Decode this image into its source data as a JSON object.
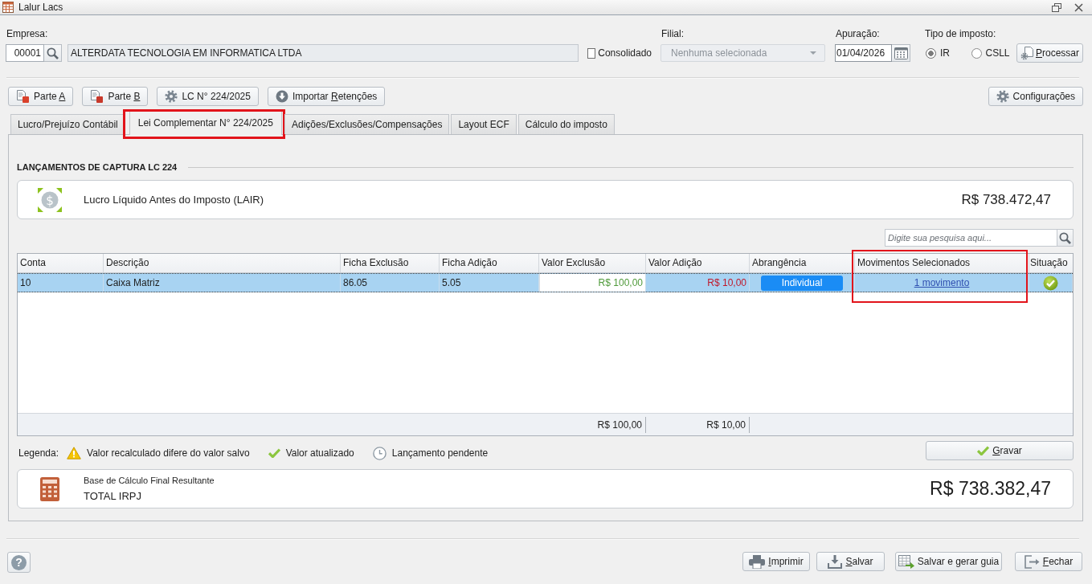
{
  "window": {
    "title": "Lalur Lacs"
  },
  "empresa": {
    "label": "Empresa:",
    "code": "00001",
    "name": "ALTERDATA TECNOLOGIA EM INFORMATICA LTDA"
  },
  "consolidado": {
    "label": "Consolidado",
    "checked": false
  },
  "filial": {
    "label": "Filial:",
    "value": "Nenhuma selecionada",
    "disabled": true
  },
  "apuracao": {
    "label": "Apuração:",
    "value": "01/04/2026"
  },
  "tipo_imposto": {
    "label": "Tipo de imposto:",
    "options": [
      {
        "label": "IR",
        "selected": true
      },
      {
        "label": "CSLL",
        "selected": false
      }
    ]
  },
  "processar_button": {
    "key": "P",
    "after": "rocessar"
  },
  "toolbar": {
    "left": [
      {
        "kind": "part_a",
        "before": "Parte ",
        "key": "A"
      },
      {
        "kind": "part_b",
        "before": "Parte ",
        "key": "B"
      },
      {
        "kind": "gear",
        "text": "LC N° 224/2025"
      },
      {
        "kind": "import",
        "before": "Importar ",
        "key": "R",
        "after": "etenções"
      }
    ],
    "right": [
      {
        "kind": "gear",
        "text": "Configurações"
      }
    ]
  },
  "tabs": [
    {
      "label": "Lucro/Prejuízo Contábil",
      "selected": false,
      "outlined": false
    },
    {
      "label": "Lei Complementar N° 224/2025",
      "selected": true,
      "outlined": true
    },
    {
      "label": "Adições/Exclusões/Compensações",
      "selected": false,
      "outlined": false
    },
    {
      "label": "Layout ECF",
      "selected": false,
      "outlined": false
    },
    {
      "label": "Cálculo do imposto",
      "selected": false,
      "outlined": false
    }
  ],
  "section_title": "LANÇAMENTOS DE CAPTURA LC 224",
  "lair": {
    "symbol": "$",
    "label": "Lucro Líquido Antes do Imposto (LAIR)",
    "value": "R$ 738.472,47"
  },
  "search": {
    "placeholder": "Digite sua pesquisa aqui..."
  },
  "table": {
    "columns": [
      {
        "label": "Conta",
        "outlined": false
      },
      {
        "label": "Descrição",
        "outlined": false
      },
      {
        "label": "Ficha Exclusão",
        "outlined": false
      },
      {
        "label": "Ficha Adição",
        "outlined": false
      },
      {
        "label": "Valor Exclusão",
        "outlined": false
      },
      {
        "label": "Valor Adição",
        "outlined": false
      },
      {
        "label": "Abrangência",
        "outlined": false
      },
      {
        "label": "Movimentos Selecionados",
        "outlined": true
      },
      {
        "label": "Situação",
        "outlined": false
      }
    ],
    "rows": [
      {
        "selected": true,
        "cells": [
          {
            "kind": "text",
            "text": "10",
            "focused": false
          },
          {
            "kind": "text",
            "text": "Caixa Matriz",
            "focused": false
          },
          {
            "kind": "text",
            "text": "86.05",
            "focused": false
          },
          {
            "kind": "text",
            "text": "5.05",
            "focused": false
          },
          {
            "kind": "exclusion",
            "text": "R$ 100,00",
            "focused": true
          },
          {
            "kind": "addition",
            "text": "R$ 10,00",
            "focused": false
          },
          {
            "kind": "button",
            "text": "Individual",
            "focused": false
          },
          {
            "kind": "link",
            "text": "1 movimento",
            "focused": false
          },
          {
            "kind": "updated",
            "focused": false
          }
        ]
      }
    ],
    "totals": {
      "valor_exclusao": "R$ 100,00",
      "valor_adicao": "R$ 10,00"
    }
  },
  "legend": {
    "label": "Legenda:",
    "items": [
      {
        "kind": "warning",
        "text": "Valor recalculado difere do valor salvo"
      },
      {
        "kind": "updated",
        "text": "Valor atualizado"
      },
      {
        "kind": "pending",
        "text": "Lançamento pendente"
      }
    ]
  },
  "gravar_button": {
    "key": "G",
    "after": "ravar"
  },
  "total": {
    "title": "Base de Cálculo Final Resultante",
    "label": "TOTAL IRPJ",
    "value": "R$ 738.382,47"
  },
  "help": {
    "symbol": "?"
  },
  "footer_buttons": [
    {
      "kind": "print",
      "key": "I",
      "after": "mprimir"
    },
    {
      "kind": "save",
      "key": "S",
      "after": "alvar"
    },
    {
      "kind": "guide",
      "before": "Salvar e gerar ",
      "key": "g",
      "after": "uia"
    },
    {
      "kind": "exit",
      "key": "F",
      "after": "echar"
    }
  ]
}
